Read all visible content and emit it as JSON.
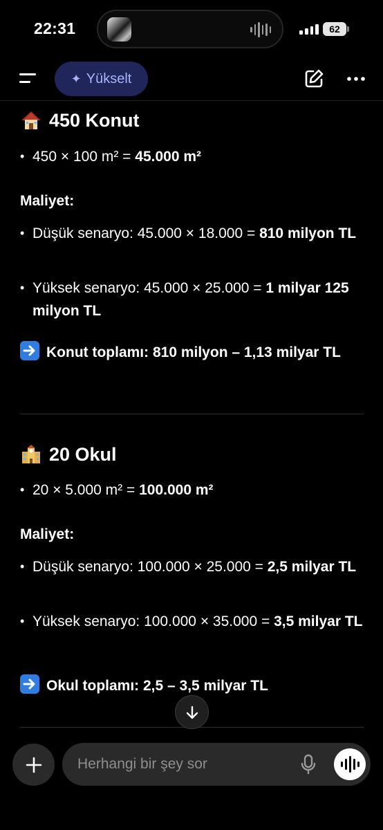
{
  "status_bar": {
    "time": "22:31",
    "battery": "62"
  },
  "nav": {
    "upgrade_label": "Yükselt"
  },
  "sections": {
    "housing": {
      "title": "450 Konut",
      "area_prefix": "450 × 100 m² = ",
      "area_bold": "45.000 m²",
      "cost_label": "Maliyet:",
      "low_prefix": "Düşük senaryo: 45.000 × 18.000 = ",
      "low_bold": "810 milyon TL",
      "high_prefix": "Yüksek senaryo: 45.000 × 25.000 = ",
      "high_bold": "1 milyar 125 milyon TL",
      "total": "Konut toplamı: 810 milyon – 1,13 milyar TL"
    },
    "school": {
      "title": "20 Okul",
      "area_prefix": "20 × 5.000 m² = ",
      "area_bold": "100.000 m²",
      "cost_label": "Maliyet:",
      "low_prefix": "Düşük senaryo: 100.000 × 25.000 = ",
      "low_bold": "2,5 milyar TL",
      "high_prefix": "Yüksek senaryo: 100.000 × 35.000 = ",
      "high_bold": "3,5 milyar TL",
      "total": "Okul toplamı: 2,5 – 3,5 milyar TL"
    }
  },
  "bullet_char": "•",
  "composer": {
    "placeholder": "Herhangi bir şey sor"
  },
  "icons": {
    "menu": "menu-icon",
    "upgrade": "sparkle-icon",
    "edit": "new-chat-icon",
    "more": "more-icon",
    "house": "house-icon",
    "school": "school-icon",
    "arrow": "arrow-right-icon",
    "scroll": "arrow-down-icon",
    "plus": "plus-icon",
    "mic": "mic-icon",
    "voice": "voice-mode-icon"
  },
  "colors": {
    "upgrade_bg": "#20265a",
    "upgrade_text": "#a9b2ff",
    "arrow_box": "#2f7de1"
  }
}
